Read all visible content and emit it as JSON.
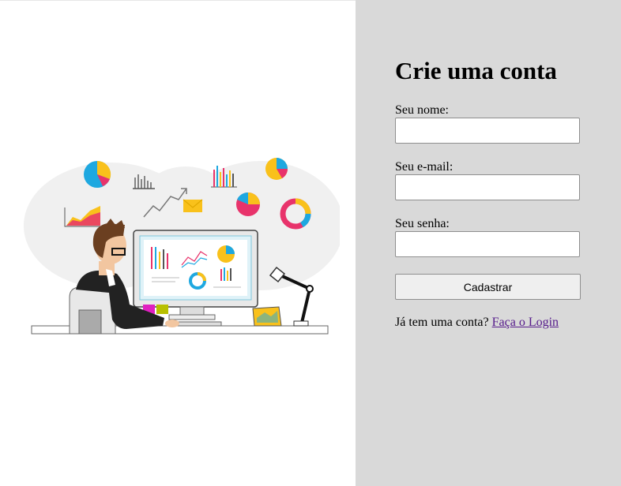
{
  "left": {
    "illustration_icon": "person-at-computer-analytics-illustration",
    "colors": {
      "blue": "#1ea8e0",
      "yellow": "#f9c11b",
      "pink": "#e8336b",
      "dark": "#333333",
      "map": "#f0f0f0"
    }
  },
  "signup": {
    "title": "Crie uma conta",
    "name_label": "Seu nome:",
    "name_value": "",
    "email_label": "Seu e-mail:",
    "email_value": "",
    "password_label": "Seu senha:",
    "password_value": "",
    "submit_label": "Cadastrar",
    "login_prompt": "Já tem uma conta?",
    "login_link": "Faça o Login"
  },
  "colors": {
    "panel_bg": "#d9d9d9",
    "link": "#551a8b"
  }
}
